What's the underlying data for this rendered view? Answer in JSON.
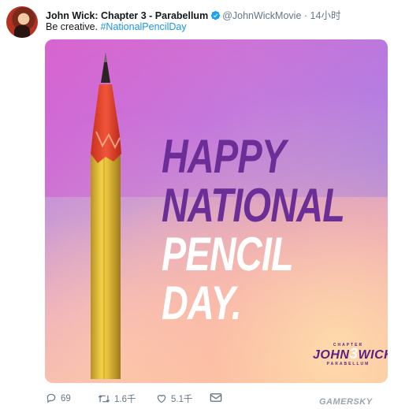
{
  "tweet": {
    "author_name": "John Wick: Chapter 3 - Parabellum",
    "handle": "@JohnWickMovie",
    "separator": "·",
    "time": "14小时",
    "text_plain": "Be creative. ",
    "hashtag": "#NationalPencilDay"
  },
  "media": {
    "headline_line1": "HAPPY",
    "headline_line2": "NATIONAL",
    "headline_line3": "PENCIL DAY.",
    "logo_top": "CHAPTER",
    "logo_john": "JOHN",
    "logo_number": "3",
    "logo_wick": "WICK",
    "logo_bottom": "PARABELLUM"
  },
  "actions": {
    "replies": "69",
    "retweets": "1.6千",
    "likes": "5.1千"
  },
  "watermark": "GAMERSKY",
  "colors": {
    "verified": "#1da1f2",
    "hashtag": "#1b95e0",
    "headline_purple": "#6b2d96",
    "pencil_yellow": "#e8c23a",
    "pencil_tip_red": "#e8452a"
  },
  "icons": [
    "verified-badge-icon",
    "reply-icon",
    "retweet-icon",
    "like-icon",
    "envelope-icon"
  ]
}
